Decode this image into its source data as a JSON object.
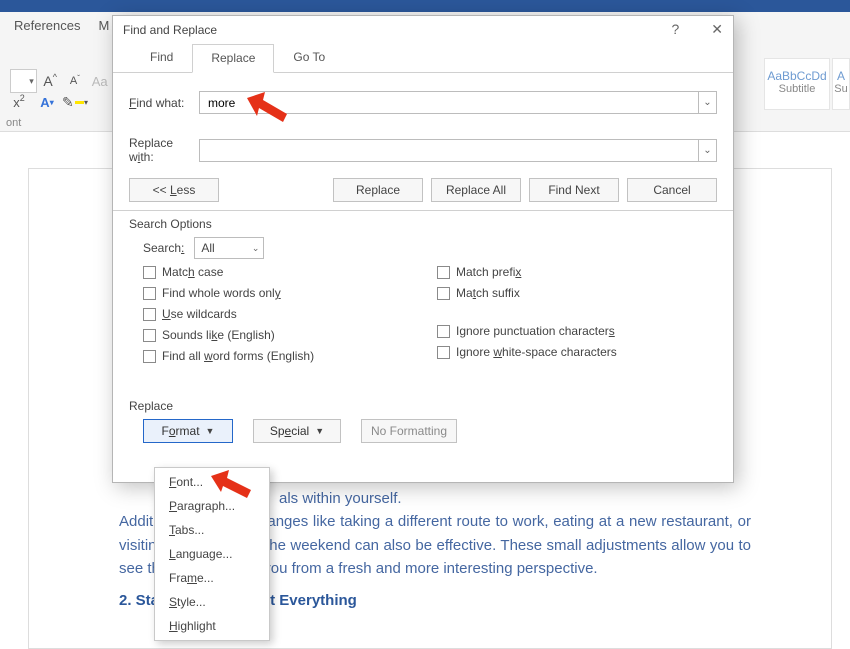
{
  "ribbon": {
    "tabs": [
      "References",
      "M"
    ],
    "group_label": "ont",
    "styles": [
      {
        "sample": "AaBbCcDd",
        "name": "Subtitle"
      },
      {
        "sample": "A",
        "name": "Su"
      }
    ]
  },
  "dialog": {
    "title": "Find and Replace",
    "tabs": {
      "find": "Find",
      "replace": "Replace",
      "goto": "Go To"
    },
    "find_label": "Find what:",
    "find_value": "more",
    "replace_label": "Replace with:",
    "replace_value": "",
    "buttons": {
      "less": "<< Less",
      "replace": "Replace",
      "replace_all": "Replace All",
      "find_next": "Find Next",
      "cancel": "Cancel"
    },
    "search_options_label": "Search Options",
    "search_label": "Search:",
    "search_scope": "All",
    "options_left": [
      "Match case",
      "Find whole words only",
      "Use wildcards",
      "Sounds like (English)",
      "Find all word forms (English)"
    ],
    "options_right": [
      "Match prefix",
      "Match suffix",
      "Ignore punctuation characters",
      "Ignore white-space characters"
    ],
    "replace_section_label": "Replace",
    "format_btn": "Format",
    "special_btn": "Special",
    "no_formatting_btn": "No Formatting"
  },
  "format_menu": [
    "Font...",
    "Paragraph...",
    "Tabs...",
    "Language...",
    "Frame...",
    "Style...",
    "Highlight"
  ],
  "document": {
    "line1": "als within yourself.",
    "para": "Additionally, simple changes like taking a different route to work, eating at a new restaurant, or visiting a museum on the weekend can also be effective. These small adjustments allow you to see the world around you from a fresh and more interesting perspective.",
    "heading": "2. Stay Curious About Everything"
  }
}
